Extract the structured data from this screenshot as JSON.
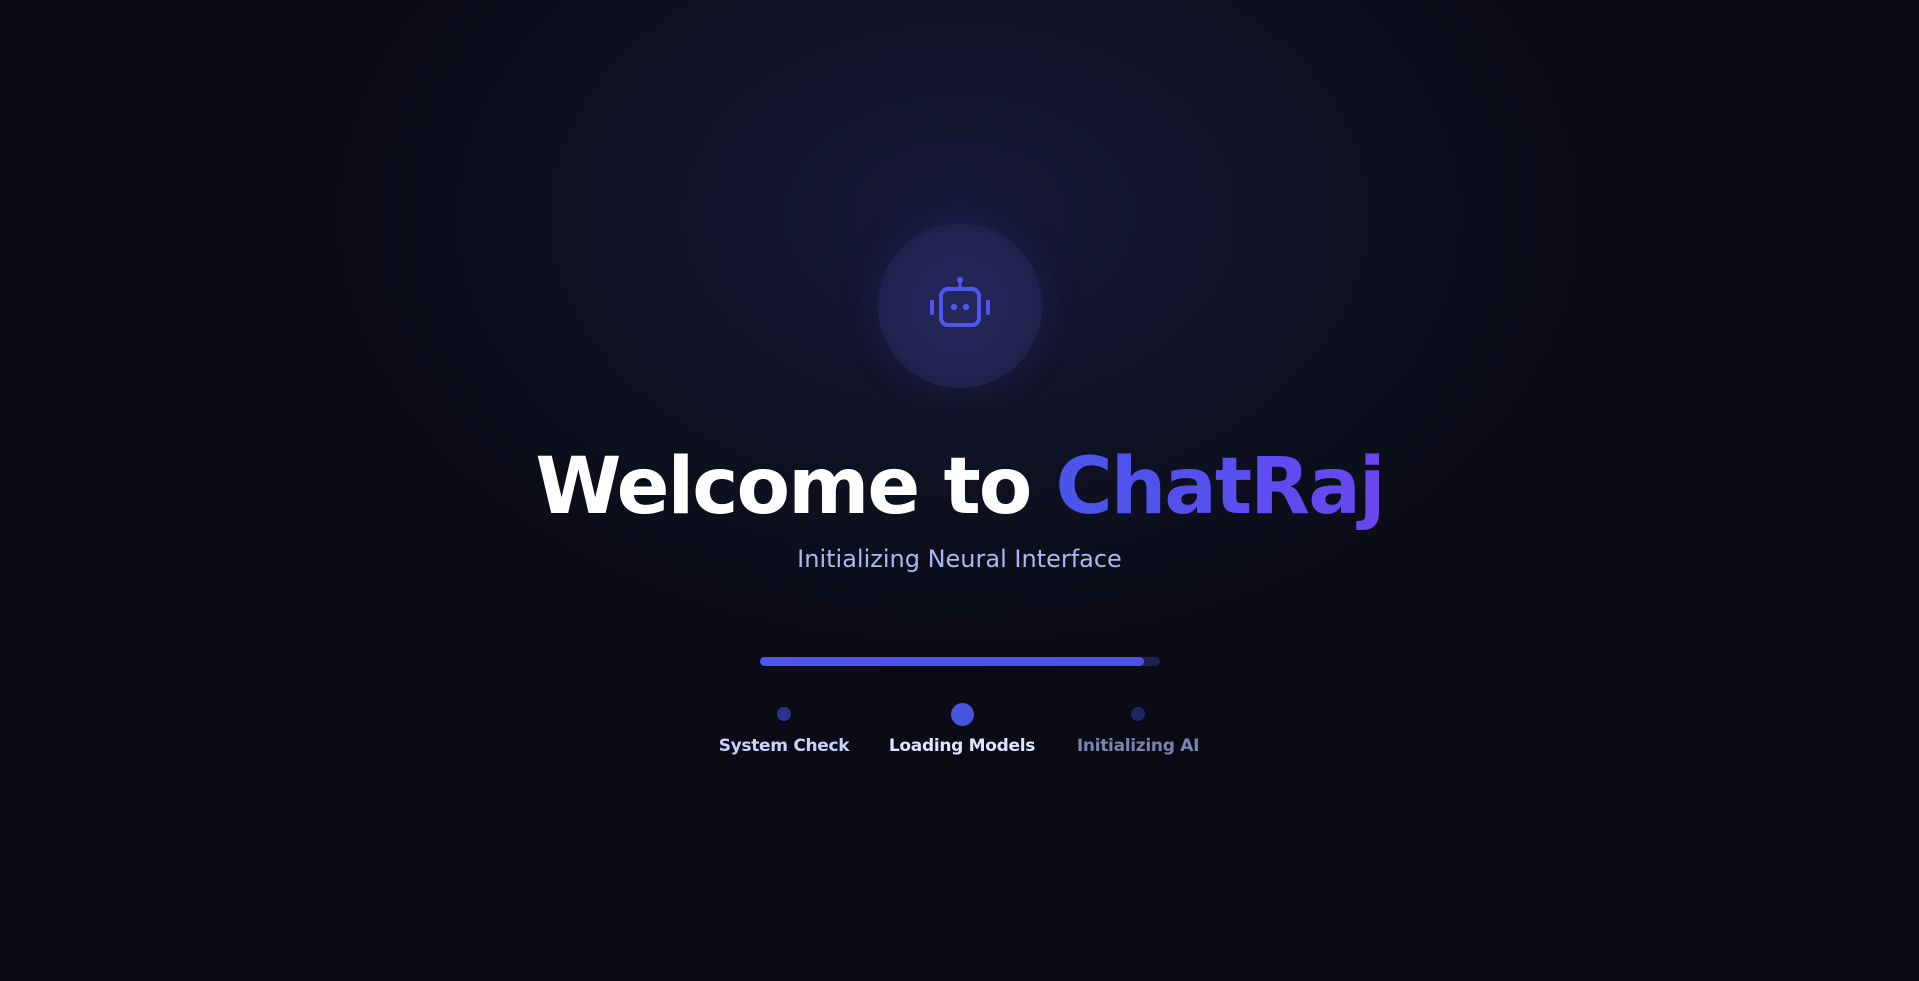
{
  "title": {
    "prefix": "Welcome to",
    "brand": "ChatRaj"
  },
  "subtitle": "Initializing Neural Interface",
  "logo": {
    "icon": "robot-icon"
  },
  "progress": {
    "value": 0.96
  },
  "steps": [
    {
      "label": "System Check",
      "state": "done"
    },
    {
      "label": "Loading Models",
      "state": "active"
    },
    {
      "label": "Initializing AI",
      "state": "pending"
    }
  ],
  "colors": {
    "accent": "#4f55ef",
    "brand_gradient_start": "#4a55e8",
    "brand_gradient_end": "#6a45ee",
    "subtitle": "#a9b8f0",
    "dot_done": "#2d338a",
    "dot_active": "#4a55df",
    "dot_pending": "#1f2465",
    "label_done": "#c7d2fe",
    "label_active": "#dfe5ff",
    "label_pending": "#7b83ad"
  }
}
